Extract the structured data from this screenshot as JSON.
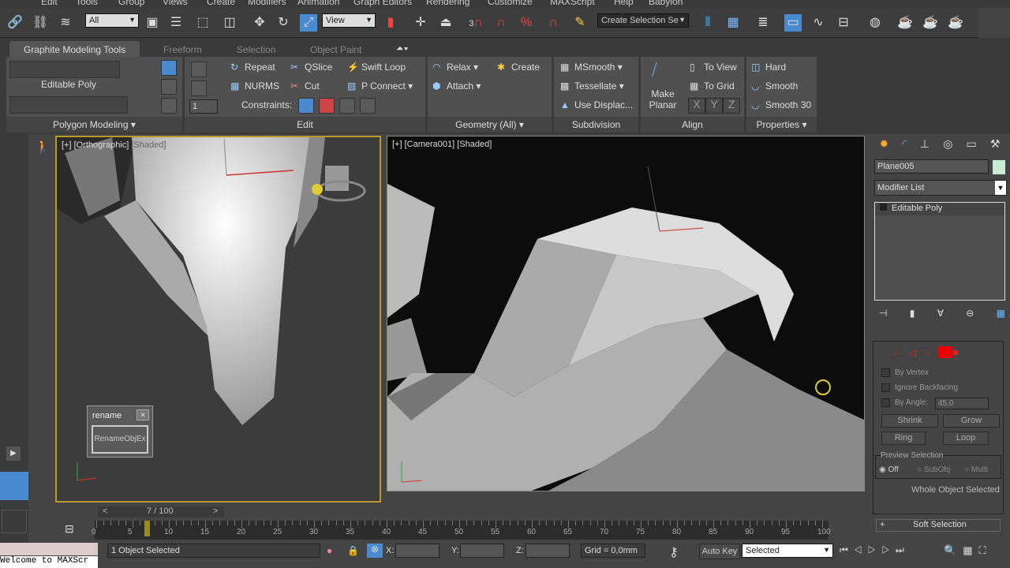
{
  "menu": [
    "Edit",
    "Tools",
    "Group",
    "Views",
    "Create",
    "Modifiers",
    "Animation",
    "Graph Editors",
    "Rendering",
    "Customize",
    "MAXScript",
    "Help",
    "Babylon"
  ],
  "toolbar": {
    "selection_filter": "All",
    "reference_coord": "View",
    "snap_angle": "3",
    "named_selection_placeholder": "Create Selection Se"
  },
  "ribbon": {
    "tabs": [
      "Graphite Modeling Tools",
      "Freeform",
      "Selection",
      "Object Paint"
    ],
    "polygon_modeling": {
      "object_type": "Editable Poly",
      "label": "Polygon Modeling",
      "spinner_value": "1"
    },
    "edit": {
      "label": "Edit",
      "items": [
        "Repeat",
        "QSlice",
        "Swift Loop",
        "NURMS",
        "Cut",
        "P Connect"
      ],
      "constraints_label": "Constraints:"
    },
    "geometry": {
      "label": "Geometry (All)",
      "items": [
        "Relax",
        "Create",
        "Attach"
      ]
    },
    "subdivision": {
      "label": "Subdivision",
      "items": [
        "MSmooth",
        "Tessellate",
        "Use Displac..."
      ]
    },
    "align": {
      "label": "Align",
      "make_planar": "Make Planar",
      "items": [
        "To View",
        "To Grid"
      ],
      "axes": [
        "X",
        "Y",
        "Z"
      ]
    },
    "properties": {
      "label": "Properties",
      "items": [
        "Hard",
        "Smooth",
        "Smooth 30"
      ]
    }
  },
  "viewports": {
    "left": {
      "label_plus": "[+]",
      "label_view": "[Orthographic]",
      "label_shade": "[Shaded]"
    },
    "right": {
      "label": "[+] [Camera001] [Shaded]"
    }
  },
  "rename_dialog": {
    "title": "rename",
    "button": "RenameObjEx"
  },
  "command_panel": {
    "object_name": "Plane005",
    "object_color": "#c8ecd4",
    "modifier_list": "Modifier List",
    "stack": [
      "Editable Poly"
    ],
    "selection": {
      "by_vertex": "By Vertex",
      "ignore_backfacing": "Ignore Backfacing",
      "by_angle": "By Angle:",
      "angle_value": "45,0",
      "shrink": "Shrink",
      "grow": "Grow",
      "ring": "Ring",
      "loop": "Loop",
      "preview_title": "Preview Selection",
      "preview_options": [
        "Off",
        "SubObj",
        "Multi"
      ],
      "preview_selected": "Off",
      "status": "Whole Object Selected"
    },
    "soft_selection": "Soft Selection"
  },
  "timeline": {
    "frame_display": "7 / 100",
    "current_frame": 7,
    "total_frames": 100,
    "ticks": [
      "0",
      "5",
      "10",
      "15",
      "20",
      "25",
      "30",
      "35",
      "40",
      "45",
      "50",
      "55",
      "60",
      "65",
      "70",
      "75",
      "80",
      "85",
      "90",
      "95",
      "100"
    ]
  },
  "status": {
    "selection": "1 Object Selected",
    "x_label": "X:",
    "y_label": "Y:",
    "z_label": "Z:",
    "grid": "Grid = 0,0mm",
    "auto_key": "Auto Key",
    "key_mode": "Selected",
    "listener": "Welcome to MAXScr"
  }
}
